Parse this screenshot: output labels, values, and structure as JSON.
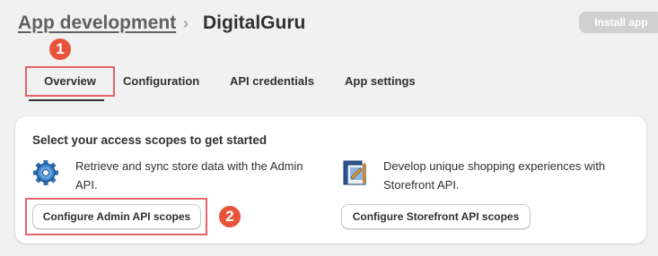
{
  "header": {
    "breadcrumb": "App development",
    "separator": "›",
    "title": "DigitalGuru",
    "install_button": "Install app"
  },
  "markers": [
    "1",
    "2"
  ],
  "tabs": [
    {
      "label": "Overview",
      "selected": true
    },
    {
      "label": "Configuration",
      "selected": false
    },
    {
      "label": "API credentials",
      "selected": false
    },
    {
      "label": "App settings",
      "selected": false
    }
  ],
  "card": {
    "title": "Select your access scopes to get started",
    "admin": {
      "icon": "gear-icon",
      "description": "Retrieve and sync store data with the Admin API.",
      "button": "Configure Admin API scopes"
    },
    "storefront": {
      "icon": "storefront-icon",
      "description": "Develop unique shopping experiences with Storefront API.",
      "button": "Configure Storefront API scopes"
    }
  },
  "colors": {
    "background": "#f1f1f1",
    "highlight": "#e8636a",
    "marker": "#e8543a",
    "install_button": "#d0d0d0"
  }
}
